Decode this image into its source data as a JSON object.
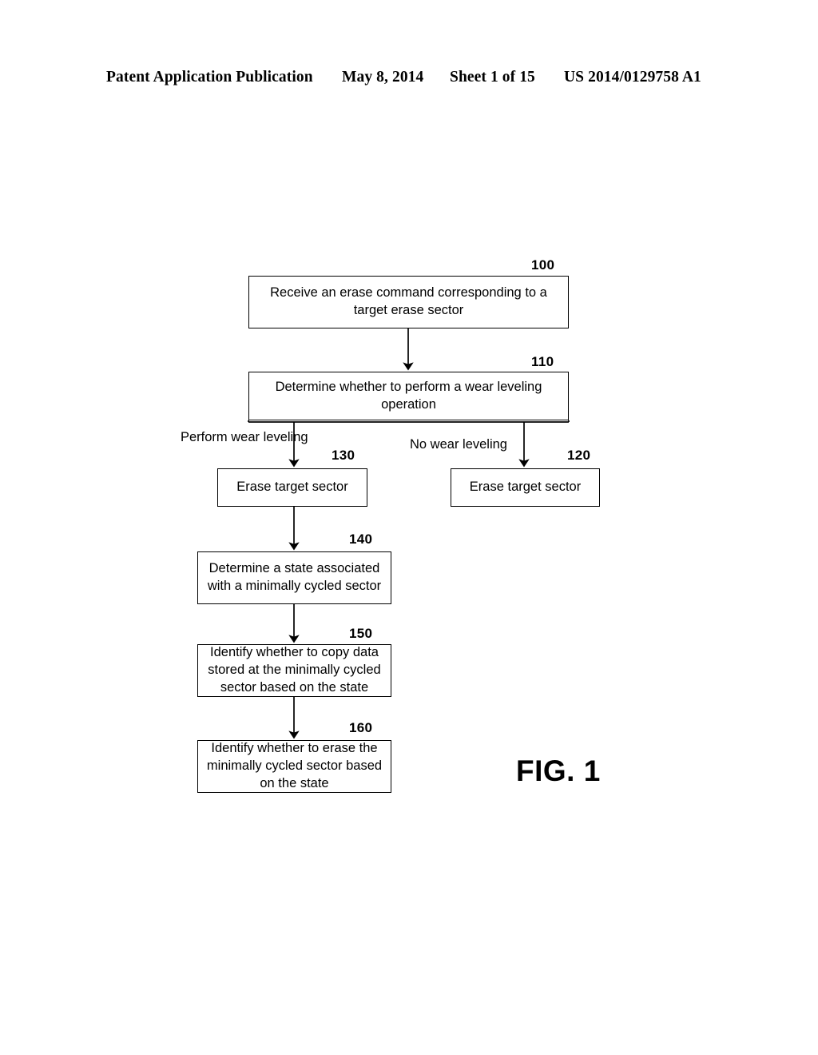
{
  "header": {
    "publication": "Patent Application Publication",
    "date": "May 8, 2014",
    "sheet": "Sheet 1 of 15",
    "patent_number": "US 2014/0129758 A1"
  },
  "figure": {
    "caption": "FIG. 1",
    "nodes": [
      {
        "ref": "100",
        "text": "Receive an erase command corresponding to a target erase sector"
      },
      {
        "ref": "110",
        "text": "Determine whether to perform a wear leveling operation"
      },
      {
        "ref": "130",
        "text": "Erase target sector"
      },
      {
        "ref": "120",
        "text": "Erase target sector"
      },
      {
        "ref": "140",
        "text": "Determine a state associated with a minimally cycled sector"
      },
      {
        "ref": "150",
        "text": "Identify whether to copy data stored at the minimally cycled sector based on the state"
      },
      {
        "ref": "160",
        "text": "Identify whether to erase the minimally cycled sector based on the state"
      }
    ],
    "edge_labels": {
      "perform_wear_leveling": "Perform wear leveling",
      "no_wear_leveling": "No wear leveling"
    },
    "line_color": "#000000"
  }
}
